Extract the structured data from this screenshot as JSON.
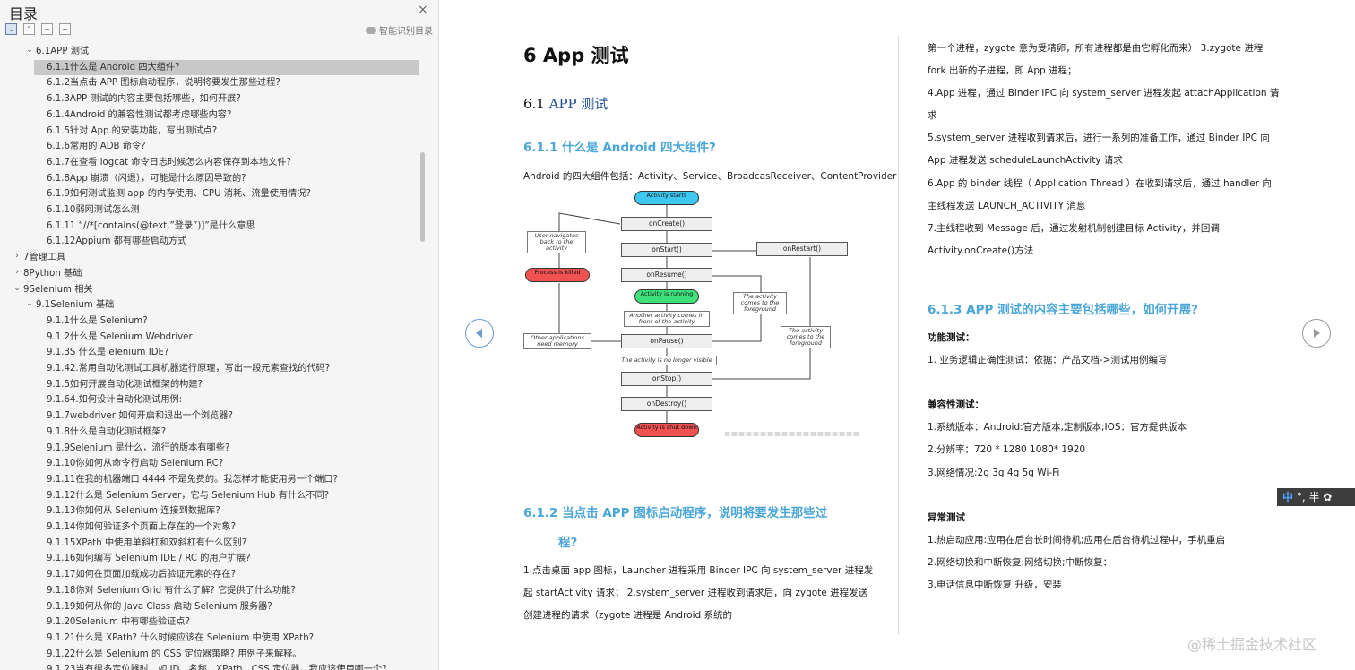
{
  "sidebar": {
    "title": "目录",
    "close_icon": "×",
    "smart_toc_label": "智能识别目录",
    "items": [
      {
        "label": "6.1APP 测试",
        "caret": "⌄"
      },
      {
        "label": "6.1.1什么是 Android 四大组件?"
      },
      {
        "label": "6.1.2当点击 APP 图标启动程序，说明将要发生那些过程?"
      },
      {
        "label": "6.1.3APP 测试的内容主要包括哪些，如何开展?"
      },
      {
        "label": "6.1.4Android 的兼容性测试都考虑哪些内容?"
      },
      {
        "label": "6.1.5针对 App 的安装功能，写出测试点?"
      },
      {
        "label": "6.1.6常用的 ADB 命令?"
      },
      {
        "label": "6.1.7在查看 logcat 命令日志时候怎么内容保存到本地文件?"
      },
      {
        "label": "6.1.8App 崩溃（闪退），可能是什么原因导致的?"
      },
      {
        "label": "6.1.9如何测试监测 app 的内存使用、CPU 消耗、流量使用情况?"
      },
      {
        "label": "6.1.10弱网测试怎么测"
      },
      {
        "label": "6.1.11 “//*[contains(@text,”登录”)]”是什么意思"
      },
      {
        "label": "6.1.12Appium 都有哪些启动方式"
      },
      {
        "label": "7管理工具",
        "caret": "›"
      },
      {
        "label": "8Python 基础",
        "caret": "›"
      },
      {
        "label": "9Selenium 相关",
        "caret": "⌄"
      },
      {
        "label": "9.1Selenium 基础",
        "caret": "⌄"
      },
      {
        "label": "9.1.1什么是 Selenium?"
      },
      {
        "label": "9.1.2什么是 Selenium Webdriver"
      },
      {
        "label": "9.1.3S 什么是 elenium IDE?"
      },
      {
        "label": "9.1.42.常用自动化测试工具机器运行原理，写出一段元素查找的代码?"
      },
      {
        "label": "9.1.5如何开展自动化测试框架的构建?"
      },
      {
        "label": "9.1.64.如何设计自动化测试用例:"
      },
      {
        "label": "9.1.7webdriver 如何开启和退出一个浏览器?"
      },
      {
        "label": "9.1.8什么是自动化测试框架?"
      },
      {
        "label": "9.1.9Selenium 是什么，流行的版本有哪些?"
      },
      {
        "label": "9.1.10你如何从命令行启动 Selenium RC?"
      },
      {
        "label": "9.1.11在我的机器端口 4444 不是免费的。我怎样才能使用另一个端口?"
      },
      {
        "label": "9.1.12什么是 Selenium Server，它与 Selenium Hub 有什么不同?"
      },
      {
        "label": "9.1.13你如何从 Selenium 连接到数据库?"
      },
      {
        "label": "9.1.14你如何验证多个页面上存在的一个对象?"
      },
      {
        "label": "9.1.15XPath 中使用单斜杠和双斜杠有什么区别?"
      },
      {
        "label": "9.1.16如何编写 Selenium IDE / RC 的用户扩展?"
      },
      {
        "label": "9.1.17如何在页面加载成功后验证元素的存在?"
      },
      {
        "label": "9.1.18你对 Selenium Grid 有什么了解? 它提供了什么功能?"
      },
      {
        "label": "9.1.19如何从你的 Java Class 启动 Selenium 服务器?"
      },
      {
        "label": "9.1.20Selenium 中有哪些验证点?"
      },
      {
        "label": "9.1.21什么是 XPath? 什么时候应该在 Selenium 中使用 XPath?"
      },
      {
        "label": "9.1.22什么是 Selenium 的 CSS 定位器策略? 用例子来解释。"
      },
      {
        "label": "9.1.23当有很多定位器时，如 ID、名称、XPath、CSS 定位器，我应该使用哪一个?"
      }
    ]
  },
  "doc": {
    "chapter_title": "6  App  测试",
    "section_num": "6.1 ",
    "section_title": "APP 测试",
    "h611": "6.1.1  什么是 Android 四大组件?",
    "p611": "Android  的四大组件包括：Activity、Service、BroadcasReceiver、ContentProvider",
    "h612a": "6.1.2   当点击  APP  图标启动程序，说明将要发生那些过",
    "h612b": "程?",
    "p612_1": "1.点击桌面  app  图标，Launcher  进程采用 Binder IPC  向  system_server  进程发",
    "p612_2": "起  startActivity  请求；  2.system_server  进程收到请求后，向  zygote  进程发送",
    "p612_3": "创建进程的请求（zygote  进程是 Android  系统的",
    "r1": "第一个进程，zygote  意为受精卵，所有进程都是由它孵化而来）  3.zygote  进程",
    "r2": "fork  出新的子进程，即  App  进程；",
    "r3": "4.App  进程，通过 Binder IPC  向  system_server  进程发起  attachApplication  请",
    "r4": "求",
    "r5": "5.system_server  进程收到请求后，进行一系列的准备工作，通过  Binder IPC  向",
    "r6": "App  进程发送 scheduleLaunchActivity  请求",
    "r7": "6.App  的  binder  线程（  Application Thread  ）在收到请求后，通过  handler  向",
    "r8": "主线程发送 LAUNCH_ACTIVITY  消息",
    "r9": "7.主线程收到  Message  后，通过发射机制创建目标  Activity，并回调",
    "r10": "Activity.onCreate()方法",
    "h613": "6.1.3  APP  测试的内容主要包括哪些，如何开展?",
    "func_label": "功能测试：",
    "func1": "1.   业务逻辑正确性测试：依据：产品文档->测试用例编写",
    "compat_label": "兼容性测试：",
    "compat1": "1.系统版本：Android:官方版本,定制版本;IOS：官方提供版本",
    "compat2": "2.分辨率：720 * 1280 1080* 1920",
    "compat3": "3.网络情况:2g 3g 4g 5g Wi-Fi",
    "except_label": "异常测试",
    "except1": "1.热启动应用:应用在后台长时间待机;应用在后台待机过程中，手机重启",
    "except2": "2.网络切换和中断恢复:网络切换;中断恢复：",
    "except3": "3.电话信息中断恢复 升级，安装"
  },
  "lifecycle": {
    "activity_starts": "Activity starts",
    "onCreate": "onCreate()",
    "onStart": "onStart()",
    "onRestart": "onRestart()",
    "onResume": "onResume()",
    "running": "Activity is running",
    "onPause": "onPause()",
    "onStop": "onStop()",
    "onDestroy": "onDestroy()",
    "shut_down": "Activity is shut down",
    "killed": "Process is killed",
    "note_navigate": "User navigates back to the activity",
    "note_other": "Other applications need memory",
    "note_another": "Another activity comes in front of the activity",
    "note_visible": "The activity is no longer visible",
    "note_fore1": "The activity comes to the foreground",
    "note_fore2": "The activity comes to the foreground"
  },
  "watermark": "@稀土掘金技术社区",
  "ime": {
    "zh": "中",
    "rest": "°, 半 ✿"
  },
  "colors": {
    "heading_blue": "#4aa6d8",
    "section_blue": "#1f4e99",
    "selected_row": "#c8c8c8"
  }
}
